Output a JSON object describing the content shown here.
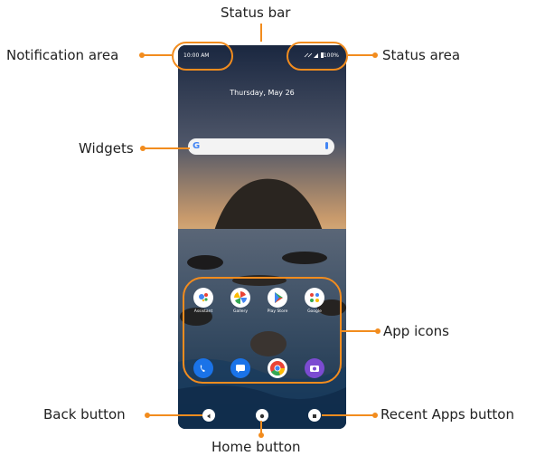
{
  "callouts": {
    "status_bar": "Status bar",
    "notification_area": "Notification area",
    "status_area": "Status area",
    "widgets": "Widgets",
    "app_icons": "App icons",
    "back_button": "Back button",
    "home_button": "Home button",
    "recent_apps_button": "Recent Apps button"
  },
  "phone": {
    "time": "10:00 AM",
    "battery": "100%",
    "date": "Thursday, May 26",
    "search_logo": "G",
    "apps": [
      {
        "label": "Assistant",
        "icon": "assistant-icon"
      },
      {
        "label": "Gallery",
        "icon": "photos-icon"
      },
      {
        "label": "Play Store",
        "icon": "play-store-icon"
      },
      {
        "label": "Google",
        "icon": "google-folder-icon"
      }
    ],
    "dock": [
      "phone-icon",
      "messages-icon",
      "chrome-icon",
      "camera-icon"
    ]
  },
  "colors": {
    "accent": "#F28C1E"
  }
}
